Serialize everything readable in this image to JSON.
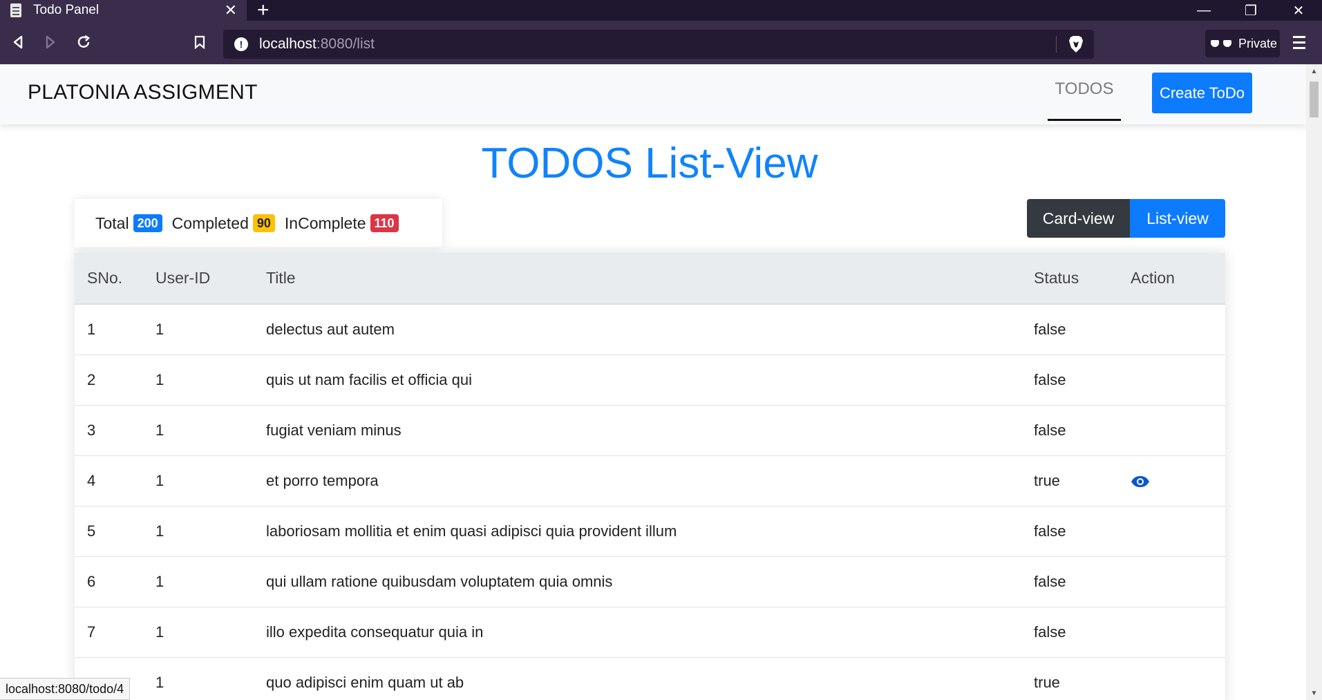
{
  "browser": {
    "tab_title": "Todo Panel",
    "url_host": "localhost",
    "url_rest": ":8080/list",
    "private_label": "Private",
    "status_url": "localhost:8080/todo/4"
  },
  "app": {
    "brand": "PLATONIA ASSIGMENT",
    "nav_todos": "TODOS",
    "create_button": "Create ToDo",
    "page_title": "TODOS List-View"
  },
  "stats": {
    "total_label": "Total",
    "total_value": "200",
    "completed_label": "Completed",
    "completed_value": "90",
    "incomplete_label": "InComplete",
    "incomplete_value": "110"
  },
  "view_toggle": {
    "card_label": "Card-view",
    "list_label": "List-view"
  },
  "table": {
    "headers": {
      "sno": "SNo.",
      "user_id": "User-ID",
      "title": "Title",
      "status": "Status",
      "action": "Action"
    },
    "rows": [
      {
        "sno": "1",
        "user_id": "1",
        "title": "delectus aut autem",
        "status": "false"
      },
      {
        "sno": "2",
        "user_id": "1",
        "title": "quis ut nam facilis et officia qui",
        "status": "false"
      },
      {
        "sno": "3",
        "user_id": "1",
        "title": "fugiat veniam minus",
        "status": "false"
      },
      {
        "sno": "4",
        "user_id": "1",
        "title": "et porro tempora",
        "status": "true"
      },
      {
        "sno": "5",
        "user_id": "1",
        "title": "laboriosam mollitia et enim quasi adipisci quia provident illum",
        "status": "false"
      },
      {
        "sno": "6",
        "user_id": "1",
        "title": "qui ullam ratione quibusdam voluptatem quia omnis",
        "status": "false"
      },
      {
        "sno": "7",
        "user_id": "1",
        "title": "illo expedita consequatur quia in",
        "status": "false"
      },
      {
        "sno": "",
        "user_id": "1",
        "title": "quo adipisci enim quam ut ab",
        "status": "true"
      }
    ]
  },
  "colors": {
    "accent": "#0d7bfe",
    "title_blue": "#1083fb",
    "badge_yellow": "#ffc107",
    "badge_red": "#dc3545",
    "dark_button": "#343a40",
    "browser_chrome": "#3a2d4c"
  }
}
